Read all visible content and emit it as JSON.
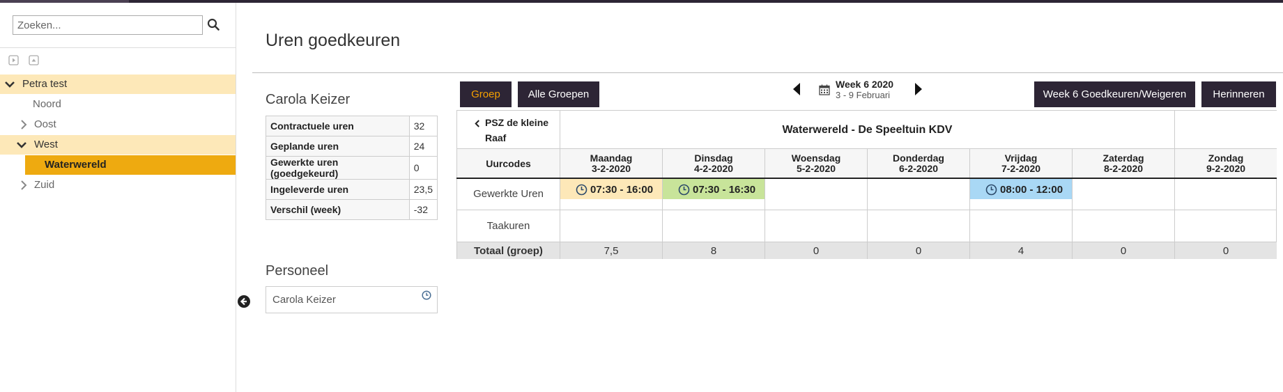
{
  "sidebar": {
    "search_placeholder": "Zoeken...",
    "tree": [
      {
        "label": "Petra test"
      },
      {
        "label": "Noord"
      },
      {
        "label": "Oost"
      },
      {
        "label": "West"
      },
      {
        "label": "Waterwereld"
      },
      {
        "label": "Zuid"
      }
    ]
  },
  "page": {
    "title": "Uren goedkeuren",
    "employee_name": "Carola Keizer",
    "stats": [
      {
        "label": "Contractuele uren",
        "value": "32"
      },
      {
        "label": "Geplande uren",
        "value": "24"
      },
      {
        "label": "Gewerkte uren (goedgekeurd)",
        "value": "0"
      },
      {
        "label": "Ingeleverde uren",
        "value": "23,5"
      },
      {
        "label": "Verschil (week)",
        "value": "-32"
      }
    ],
    "personeel_heading": "Personeel",
    "personeel_items": [
      "Carola Keizer"
    ]
  },
  "toolbar": {
    "groep": "Groep",
    "alle_groepen": "Alle Groepen",
    "week_title": "Week 6 2020",
    "week_range": "3 - 9 Februari",
    "approve": "Week 6 Goedkeuren/Weigeren",
    "remind": "Herinneren"
  },
  "schedule": {
    "group_back": "PSZ de kleine Raaf",
    "location": "Waterwereld - De Speeltuin KDV",
    "uurcodes": "Uurcodes",
    "days": [
      {
        "name": "Maandag",
        "date": "3-2-2020"
      },
      {
        "name": "Dinsdag",
        "date": "4-2-2020"
      },
      {
        "name": "Woensdag",
        "date": "5-2-2020"
      },
      {
        "name": "Donderdag",
        "date": "6-2-2020"
      },
      {
        "name": "Vrijdag",
        "date": "7-2-2020"
      },
      {
        "name": "Zaterdag",
        "date": "8-2-2020"
      },
      {
        "name": "Zondag",
        "date": "9-2-2020"
      }
    ],
    "rows": [
      {
        "label": "Gewerkte Uren",
        "cells": [
          "07:30 - 16:00",
          "07:30 - 16:30",
          "",
          "",
          "08:00 - 12:00",
          "",
          ""
        ]
      },
      {
        "label": "Taakuren",
        "cells": [
          "",
          "",
          "",
          "",
          "",
          "",
          ""
        ]
      }
    ],
    "shift_colors": [
      "#fde8b8",
      "#c8e49a",
      "",
      "",
      "#a9d8f5",
      "",
      ""
    ],
    "total_label": "Totaal (groep)",
    "totals": [
      "7,5",
      "8",
      "0",
      "0",
      "4",
      "0",
      "0"
    ]
  }
}
